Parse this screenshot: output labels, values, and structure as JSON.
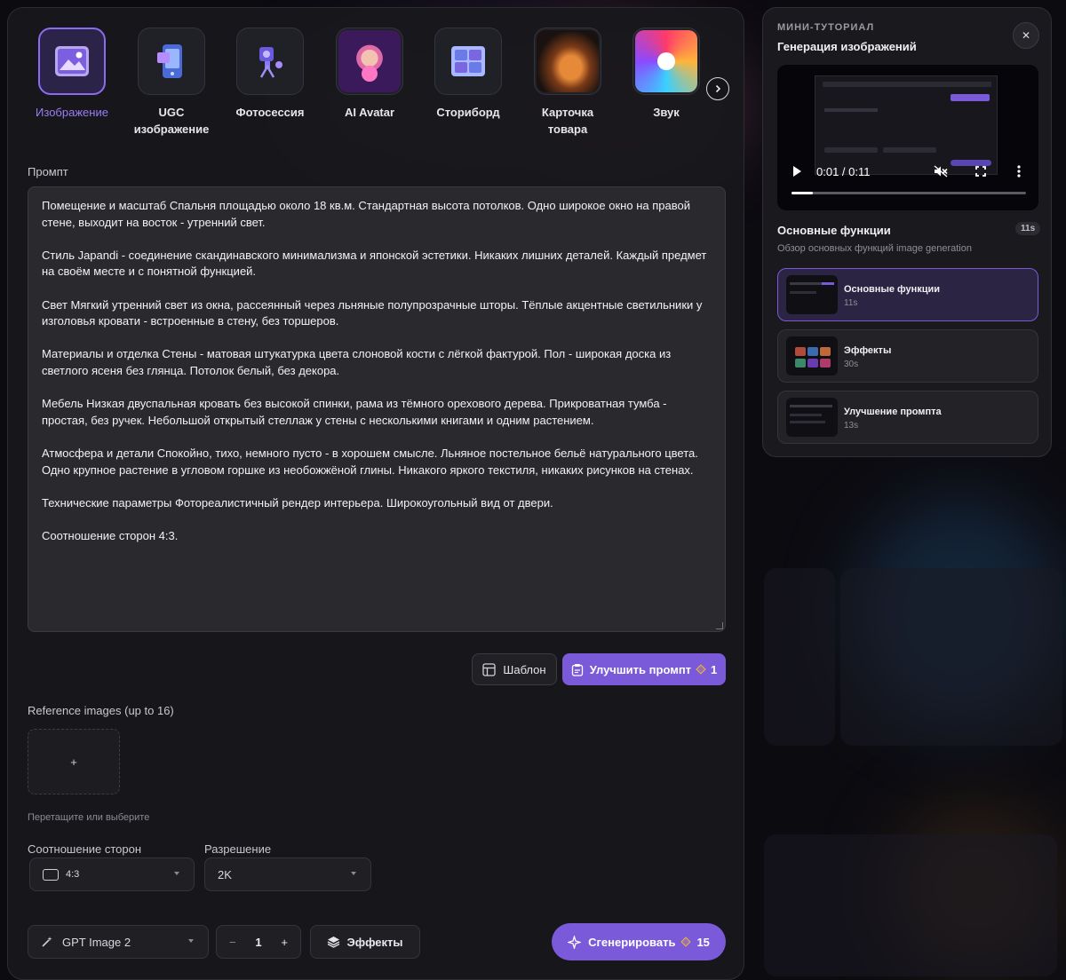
{
  "categories": [
    {
      "label": "Изображение",
      "active": true,
      "icon": "image-icon"
    },
    {
      "label": "UGC изображение",
      "active": false,
      "icon": "phone-image-icon"
    },
    {
      "label": "Фотосессия",
      "active": false,
      "icon": "camera-icon"
    },
    {
      "label": "AI Avatar",
      "active": false,
      "icon": "avatar-thumbnail"
    },
    {
      "label": "Сториборд",
      "active": false,
      "icon": "storyboard-icon"
    },
    {
      "label": "Карточка товара",
      "active": false,
      "icon": "shoe-thumbnail"
    },
    {
      "label": "Звук",
      "active": false,
      "icon": "sound-thumbnail"
    }
  ],
  "prompt": {
    "label": "Промпт",
    "paragraphs": [
      "Помещение и масштаб Спальня площадью около 18 кв.м. Стандартная высота потолков. Одно широкое окно на правой стене, выходит на восток - утренний свет.",
      "Стиль Japandi - соединение скандинавского минимализма и японской эстетики. Никаких лишних деталей. Каждый предмет на своём месте и с понятной функцией.",
      "Свет Мягкий утренний свет из окна, рассеянный через льняные полупрозрачные шторы. Тёплые акцентные светильники у изголовья кровати - встроенные в стену, без торшеров.",
      "Материалы и отделка Стены - матовая штукатурка цвета слоновой кости с лёгкой фактурой. Пол - широкая доска из светлого ясеня без глянца. Потолок белый, без декора.",
      "Мебель Низкая двуспальная кровать без высокой спинки, рама из тёмного орехового дерева. Прикроватная тумба - простая, без ручек. Небольшой открытый стеллаж у стены с несколькими книгами и одним растением.",
      "Атмосфера и детали Спокойно, тихо, немного пусто - в хорошем смысле. Льняное постельное бельё натурального цвета. Одно крупное растение в угловом горшке из необожжёной глины. Никакого яркого текстиля, никаких рисунков на стенах.",
      "Технические параметры Фотореалистичный рендер интерьера. Широкоугольный вид от двери.",
      "Соотношение сторон 4:3."
    ]
  },
  "actions": {
    "template_label": "Шаблон",
    "improve_label": "Улучшить промпт",
    "improve_cost": "1"
  },
  "reference": {
    "label": "Reference images (up to 16)",
    "add_symbol": "+",
    "hint": "Перетащите или выберите"
  },
  "settings": {
    "aspect_label": "Соотношение сторон",
    "aspect_value": "4:3",
    "resolution_label": "Разрешение",
    "resolution_value": "2K"
  },
  "footer": {
    "model": "GPT Image 2",
    "minus": "−",
    "quantity": "1",
    "plus": "+",
    "effects_label": "Эффекты",
    "generate_label": "Сгенерировать",
    "generate_cost": "15"
  },
  "tutorial": {
    "kicker": "МИНИ-ТУТОРИАЛ",
    "title": "Генерация изображений",
    "close": "✕",
    "video_time": "0:01 / 0:11",
    "video_progress": 0.09,
    "section_title": "Основные функции",
    "section_sub": "Обзор основных функций image generation",
    "section_duration": "11s",
    "clips": [
      {
        "title": "Основные функции",
        "duration": "11s",
        "active": true
      },
      {
        "title": "Эффекты",
        "duration": "30s",
        "active": false
      },
      {
        "title": "Улучшение промпта",
        "duration": "13s",
        "active": false
      }
    ]
  },
  "colors": {
    "accent": "#7a5ad8",
    "accent_light": "#9a7cf6",
    "gem": "#f0b43a",
    "panel": "#18181c"
  }
}
